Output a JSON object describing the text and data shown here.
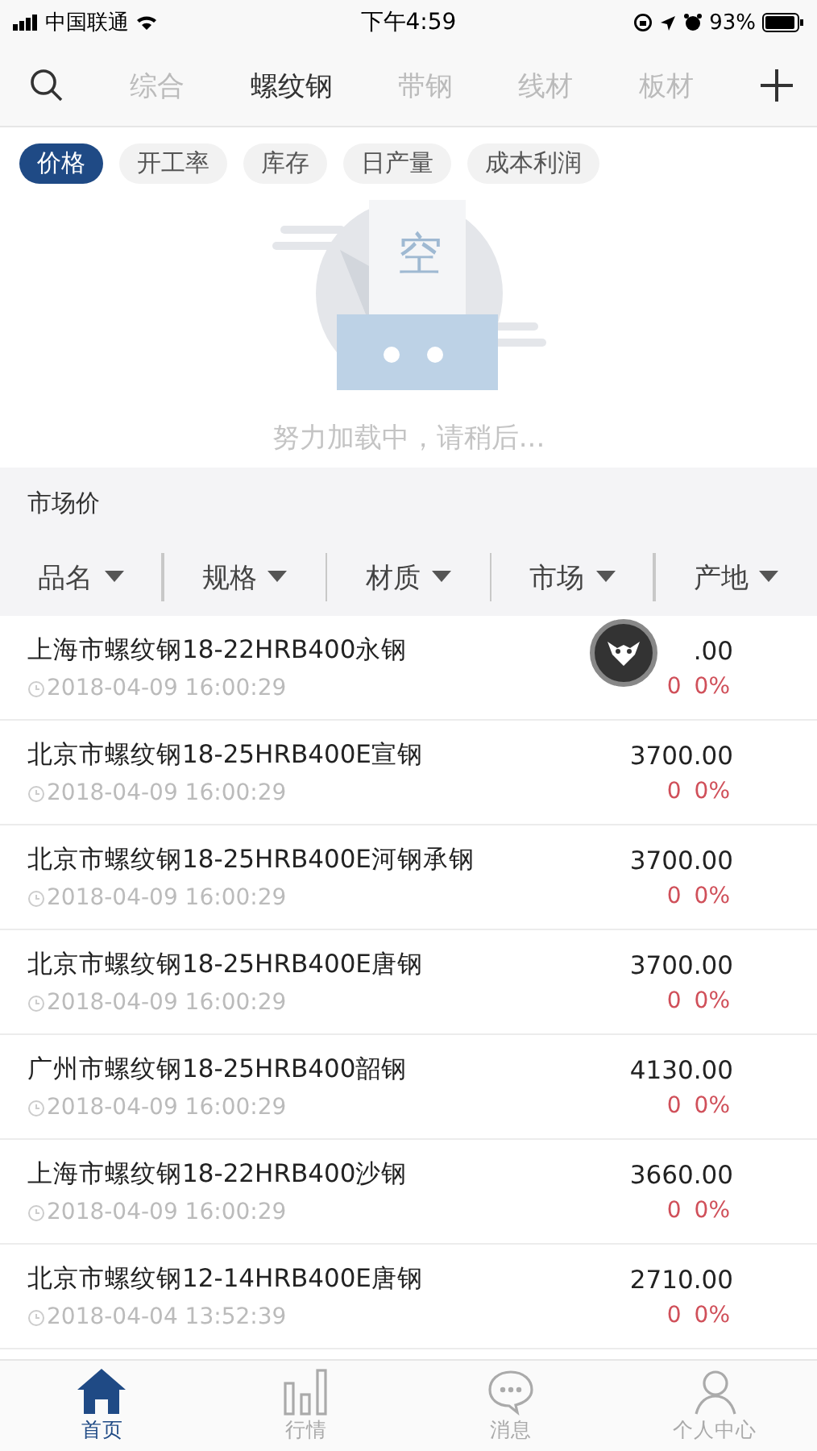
{
  "status_bar": {
    "carrier": "中国联通",
    "time": "下午4:59",
    "battery": "93%"
  },
  "tabs": [
    {
      "label": "综合",
      "selected": false
    },
    {
      "label": "螺纹钢",
      "selected": true
    },
    {
      "label": "带钢",
      "selected": false
    },
    {
      "label": "线材",
      "selected": false
    },
    {
      "label": "板材",
      "selected": false
    }
  ],
  "chips": [
    {
      "label": "价格",
      "selected": true
    },
    {
      "label": "开工率",
      "selected": false
    },
    {
      "label": "库存",
      "selected": false
    },
    {
      "label": "日产量",
      "selected": false
    },
    {
      "label": "成本利润",
      "selected": false
    }
  ],
  "empty_state": {
    "glyph": "空",
    "message": "努力加载中，请稍后..."
  },
  "section_title": "市场价",
  "filters": [
    "品名",
    "规格",
    "材质",
    "市场",
    "产地"
  ],
  "rows": [
    {
      "name": "上海市螺纹钢18-22HRB400永钢",
      "time": "2018-04-09 16:00:29",
      "price": ".00",
      "change": "0",
      "percent": "0%"
    },
    {
      "name": "北京市螺纹钢18-25HRB400E宣钢",
      "time": "2018-04-09 16:00:29",
      "price": "3700.00",
      "change": "0",
      "percent": "0%"
    },
    {
      "name": "北京市螺纹钢18-25HRB400E河钢承钢",
      "time": "2018-04-09 16:00:29",
      "price": "3700.00",
      "change": "0",
      "percent": "0%"
    },
    {
      "name": "北京市螺纹钢18-25HRB400E唐钢",
      "time": "2018-04-09 16:00:29",
      "price": "3700.00",
      "change": "0",
      "percent": "0%"
    },
    {
      "name": "广州市螺纹钢18-25HRB400韶钢",
      "time": "2018-04-09 16:00:29",
      "price": "4130.00",
      "change": "0",
      "percent": "0%"
    },
    {
      "name": "上海市螺纹钢18-22HRB400沙钢",
      "time": "2018-04-09 16:00:29",
      "price": "3660.00",
      "change": "0",
      "percent": "0%"
    },
    {
      "name": "北京市螺纹钢12-14HRB400E唐钢",
      "time": "2018-04-04 13:52:39",
      "price": "2710.00",
      "change": "0",
      "percent": "0%"
    }
  ],
  "bottom_nav": [
    {
      "label": "首页",
      "selected": true
    },
    {
      "label": "行情",
      "selected": false
    },
    {
      "label": "消息",
      "selected": false
    },
    {
      "label": "个人中心",
      "selected": false
    }
  ]
}
